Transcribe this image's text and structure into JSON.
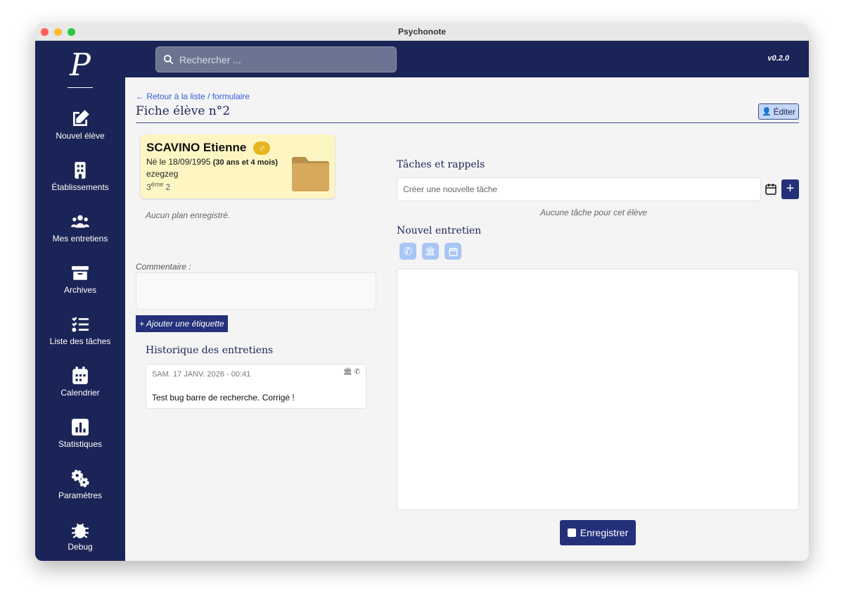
{
  "window": {
    "title": "Psychonote"
  },
  "sidebar": {
    "logo": "P",
    "items": [
      {
        "label": "Nouvel élève"
      },
      {
        "label": "Établissements"
      },
      {
        "label": "Mes entretiens"
      },
      {
        "label": "Archives"
      },
      {
        "label": "Liste des tâches"
      },
      {
        "label": "Calendrier"
      },
      {
        "label": "Statistiques"
      },
      {
        "label": "Paramètres"
      },
      {
        "label": "Debug"
      }
    ]
  },
  "header": {
    "search_placeholder": "Rechercher ...",
    "version": "v0.2.0"
  },
  "page": {
    "back_link": "← Retour à la liste / formulaire",
    "title": "Fiche élève n°2",
    "edit_label": "Éditer"
  },
  "student": {
    "name": "SCAVINO Etienne",
    "gender_symbol": "♂",
    "birth": "Né le 18/09/1995",
    "age": "(30 ans et 4 mois)",
    "school": "ezegzeg",
    "class_level": "3",
    "class_sup": "ème",
    "class_group": "2"
  },
  "plan": {
    "empty": "Aucun plan enregistré."
  },
  "comment": {
    "label": "Commentaire :",
    "value": ""
  },
  "tag_button": "+ Ajouter une étiquette",
  "history": {
    "title": "Historique des entretiens",
    "items": [
      {
        "date": "SAM. 17 JANV. 2026 - 00:41",
        "text": "Test bug barre de recherche. Corrigé !"
      }
    ]
  },
  "tasks": {
    "title": "Tâches et rappels",
    "placeholder": "Créer une nouvelle tâche",
    "empty": "Aucune tâche pour cet élève",
    "add": "+"
  },
  "interview": {
    "title": "Nouvel entretien",
    "save_label": "Enregistrer"
  },
  "colors": {
    "navy": "#1b2456",
    "accent": "#24317a",
    "card": "#fdf6c3"
  }
}
